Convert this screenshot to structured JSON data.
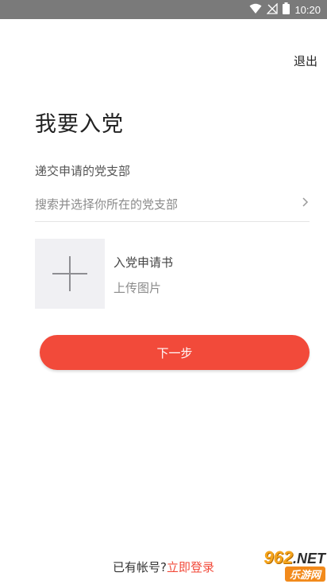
{
  "status_bar": {
    "time": "10:20"
  },
  "header": {
    "logout_label": "退出"
  },
  "page": {
    "title": "我要入党"
  },
  "branch": {
    "label": "递交申请的党支部",
    "placeholder": "搜索并选择你所在的党支部"
  },
  "upload": {
    "title": "入党申请书",
    "subtitle": "上传图片"
  },
  "actions": {
    "next_label": "下一步"
  },
  "footer": {
    "question": "已有帐号?",
    "login_label": "立即登录"
  },
  "watermark": {
    "brand_number": "962",
    "brand_suffix": ".NET",
    "brand_name": "乐游网"
  },
  "colors": {
    "accent": "#f24a3a",
    "status_bar": "#7a7a7a",
    "upload_bg": "#f0f0f3"
  }
}
